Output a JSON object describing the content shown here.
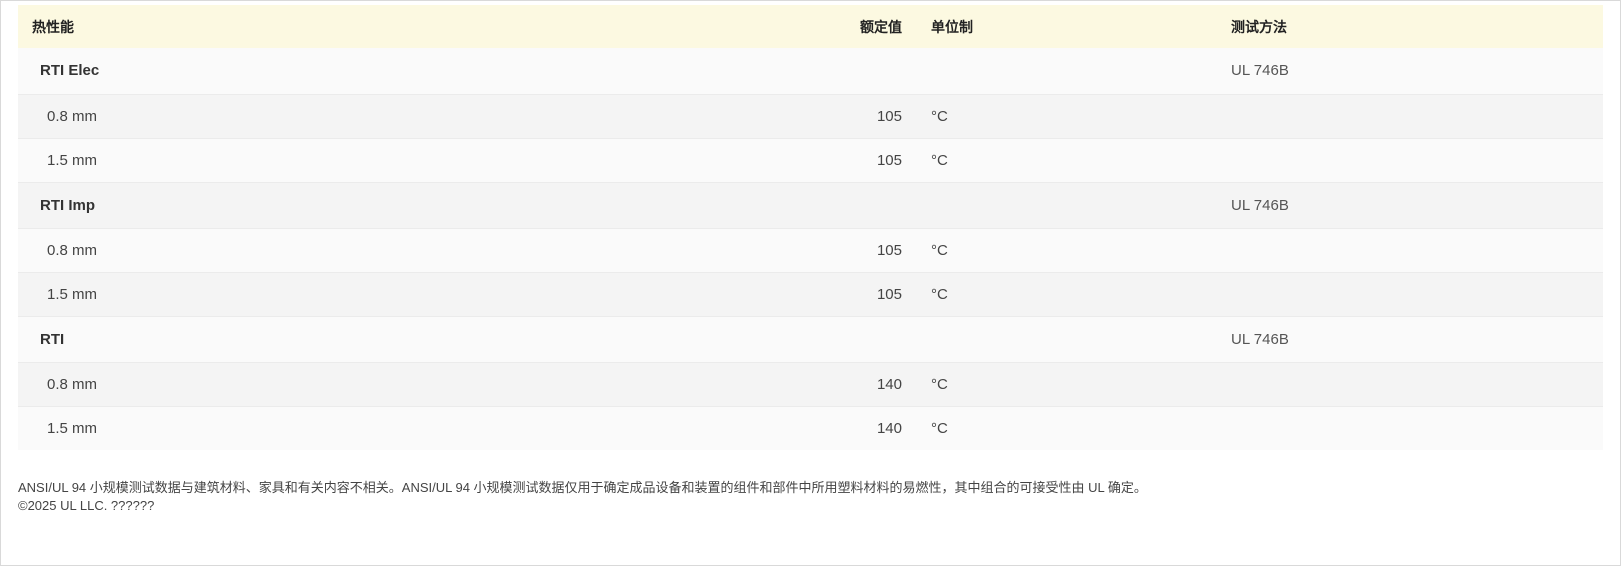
{
  "table": {
    "headers": {
      "property": "热性能",
      "value": "额定值",
      "unit": "单位制",
      "method": "测试方法"
    },
    "rows": [
      {
        "type": "group",
        "property": "RTI Elec",
        "value": "",
        "unit": "",
        "method": "UL 746B"
      },
      {
        "type": "sub",
        "property": "0.8 mm",
        "value": "105",
        "unit": "°C",
        "method": ""
      },
      {
        "type": "sub",
        "property": "1.5 mm",
        "value": "105",
        "unit": "°C",
        "method": ""
      },
      {
        "type": "group",
        "property": "RTI Imp",
        "value": "",
        "unit": "",
        "method": "UL 746B"
      },
      {
        "type": "sub",
        "property": "0.8 mm",
        "value": "105",
        "unit": "°C",
        "method": ""
      },
      {
        "type": "sub",
        "property": "1.5 mm",
        "value": "105",
        "unit": "°C",
        "method": ""
      },
      {
        "type": "group",
        "property": "RTI",
        "value": "",
        "unit": "",
        "method": "UL 746B"
      },
      {
        "type": "sub",
        "property": "0.8 mm",
        "value": "140",
        "unit": "°C",
        "method": ""
      },
      {
        "type": "sub",
        "property": "1.5 mm",
        "value": "140",
        "unit": "°C",
        "method": ""
      }
    ]
  },
  "footnote": {
    "disclaimer": "ANSI/UL 94 小规模测试数据与建筑材料、家具和有关内容不相关。ANSI/UL 94 小规模测试数据仅用于确定成品设备和装置的组件和部件中所用塑料材料的易燃性，其中组合的可接受性由 UL 确定。",
    "copyright": "©2025 UL LLC. ??????"
  },
  "colors": {
    "header_background": "#fcf9e1",
    "row_light": "#fafafa",
    "row_dark": "#f4f4f4"
  }
}
